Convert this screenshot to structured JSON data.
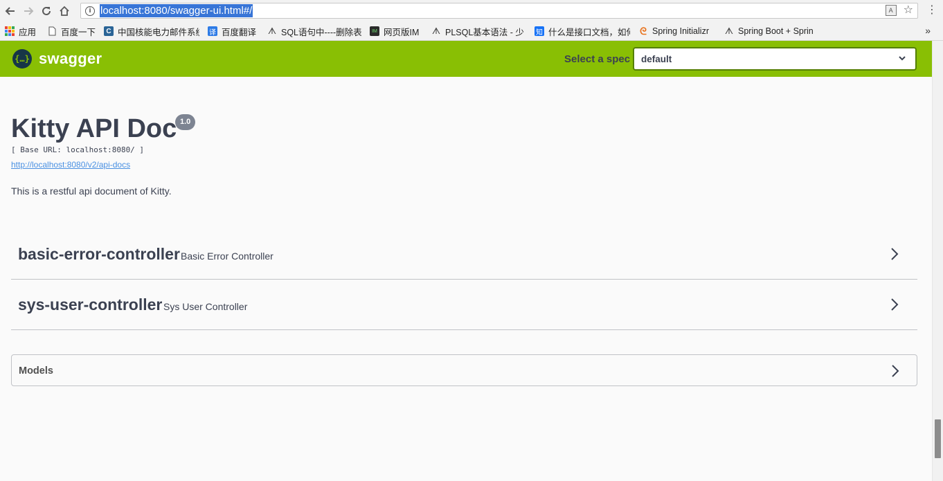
{
  "browser": {
    "url": "localhost:8080/swagger-ui.html#/",
    "info_icon": "i",
    "translate_icon": "A",
    "star_icon": "☆",
    "menu_icon": "⋮",
    "bookmarks": [
      {
        "label": "应用",
        "icon": "apps-grid-icon"
      },
      {
        "label": "百度一下",
        "icon": "page-icon"
      },
      {
        "label": "中国核能电力邮件系统",
        "icon": "c-icon",
        "icon_color": "#2a6496",
        "icon_text": "C"
      },
      {
        "label": "百度翻译",
        "icon": "translate-icon",
        "icon_color": "#2d7be6",
        "icon_text": "译"
      },
      {
        "label": "SQL语句中----删除表",
        "icon": "wolf-icon",
        "icon_text": "ᗑ"
      },
      {
        "label": "网页版IM",
        "icon": "im-icon",
        "icon_color": "#2b2b2b",
        "icon_text": "IM"
      },
      {
        "label": "PLSQL基本语法 - 少",
        "icon": "wolf-icon",
        "icon_text": "ᗑ"
      },
      {
        "label": "什么是接口文档，如何",
        "icon": "zhihu-icon",
        "icon_color": "#1772f6",
        "icon_text": "知"
      },
      {
        "label": "Spring Initializr",
        "icon": "spring-icon",
        "icon_color": "#e8711b",
        "icon_text": "ᘓ"
      },
      {
        "label": "Spring Boot + Sprin",
        "icon": "wolf-icon",
        "icon_text": "ᗑ"
      }
    ],
    "more_icon": "»"
  },
  "topbar": {
    "brand": "swagger",
    "logo_glyph": "{…}",
    "spec_label": "Select a spec",
    "spec_value": "default",
    "brand_color": "#89bf04"
  },
  "info": {
    "title": "Kitty API Doc",
    "version": "1.0",
    "base_url": "[ Base URL: localhost:8080/ ]",
    "docs_link": "http://localhost:8080/v2/api-docs",
    "description": "This is a restful api document of Kitty."
  },
  "tags": [
    {
      "name": "basic-error-controller",
      "description": "Basic Error Controller"
    },
    {
      "name": "sys-user-controller",
      "description": "Sys User Controller"
    }
  ],
  "models": {
    "title": "Models"
  }
}
